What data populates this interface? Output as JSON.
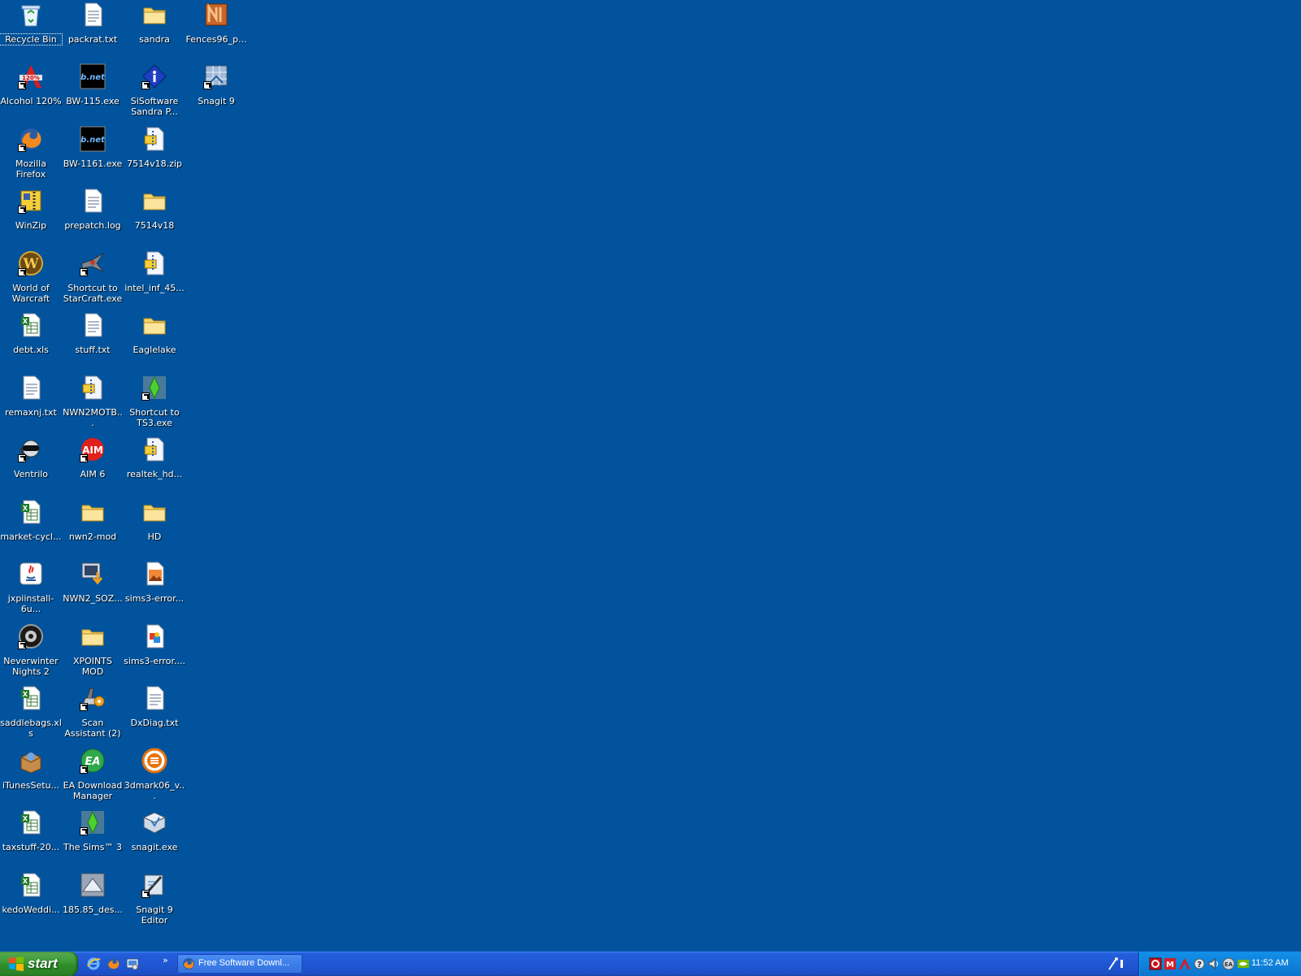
{
  "desktop": {
    "background_color": "#00539c",
    "selected_icon": "Recycle Bin",
    "icons": [
      {
        "label": "Recycle Bin",
        "icon": "recycle-bin-icon"
      },
      {
        "label": "packrat.txt",
        "icon": "text-file-icon"
      },
      {
        "label": "sandra",
        "icon": "folder-icon"
      },
      {
        "label": "Fences96_p...",
        "icon": "installer-icon"
      },
      {
        "label": "Alcohol 120%",
        "icon": "alcohol-icon"
      },
      {
        "label": "BW-115.exe",
        "icon": "bnet-exe-icon"
      },
      {
        "label": "SiSoftware Sandra P...",
        "icon": "sisoftware-icon"
      },
      {
        "label": "Snagit 9",
        "icon": "snagit-icon"
      },
      {
        "label": "Mozilla Firefox",
        "icon": "firefox-icon"
      },
      {
        "label": "BW-1161.exe",
        "icon": "bnet-exe-icon"
      },
      {
        "label": "7514v18.zip",
        "icon": "zip-file-icon"
      },
      {
        "label": "WinZip",
        "icon": "winzip-icon"
      },
      {
        "label": "prepatch.log",
        "icon": "text-file-icon"
      },
      {
        "label": "7514v18",
        "icon": "folder-icon"
      },
      {
        "label": "World of Warcraft",
        "icon": "warcraft-icon"
      },
      {
        "label": "Shortcut to StarCraft.exe",
        "icon": "starcraft-icon"
      },
      {
        "label": "intel_inf_45...",
        "icon": "zip-file-icon"
      },
      {
        "label": "debt.xls",
        "icon": "excel-file-icon"
      },
      {
        "label": "stuff.txt",
        "icon": "text-file-icon"
      },
      {
        "label": "Eaglelake",
        "icon": "folder-icon"
      },
      {
        "label": "remaxnj.txt",
        "icon": "text-file-icon"
      },
      {
        "label": "NWN2MOTB...",
        "icon": "zip-file-icon"
      },
      {
        "label": "Shortcut to TS3.exe",
        "icon": "sims-icon"
      },
      {
        "label": "Ventrilo",
        "icon": "ventrilo-icon"
      },
      {
        "label": "AIM 6",
        "icon": "aim-icon"
      },
      {
        "label": "realtek_hd...",
        "icon": "zip-file-icon"
      },
      {
        "label": "market-cycl...",
        "icon": "excel-file-icon"
      },
      {
        "label": "nwn2-mod",
        "icon": "folder-icon"
      },
      {
        "label": "HD",
        "icon": "folder-icon"
      },
      {
        "label": "jxpiinstall-6u...",
        "icon": "java-icon"
      },
      {
        "label": "NWN2_SOZ...",
        "icon": "installer-icon"
      },
      {
        "label": "sims3-error...",
        "icon": "image-file-icon"
      },
      {
        "label": "Neverwinter Nights 2",
        "icon": "neverwinter-icon"
      },
      {
        "label": "XPOINTS MOD",
        "icon": "folder-icon"
      },
      {
        "label": "sims3-error....",
        "icon": "image-file-icon"
      },
      {
        "label": "saddlebags.xls",
        "icon": "excel-file-icon"
      },
      {
        "label": "Scan Assistant (2)",
        "icon": "scan-assistant-icon"
      },
      {
        "label": "DxDiag.txt",
        "icon": "text-file-icon"
      },
      {
        "label": "iTunesSetu...",
        "icon": "itunes-setup-icon"
      },
      {
        "label": "EA Download Manager",
        "icon": "ea-icon"
      },
      {
        "label": "3dmark06_v...",
        "icon": "3dmark-icon"
      },
      {
        "label": "taxstuff-20...",
        "icon": "excel-file-icon"
      },
      {
        "label": "The Sims™ 3",
        "icon": "sims-icon"
      },
      {
        "label": "snagit.exe",
        "icon": "snagit-installer-icon"
      },
      {
        "label": "kedoWeddi...",
        "icon": "excel-file-icon"
      },
      {
        "label": "185.85_des...",
        "icon": "nvidia-installer-icon"
      },
      {
        "label": "Snagit 9 Editor",
        "icon": "snagit-editor-icon"
      }
    ]
  },
  "taskbar": {
    "start_label": "start",
    "quick_launch": [
      "internet-explorer-icon",
      "firefox-icon",
      "show-desktop-icon"
    ],
    "quick_launch_more": "»",
    "task_buttons": [
      {
        "label": "Free Software Downl...",
        "icon": "firefox-icon"
      }
    ],
    "tray_icons": [
      "antivirus-icon",
      "mcafee-icon",
      "alcohol-tray-icon",
      "help-icon",
      "volume-icon",
      "ea-tray-icon",
      "nvidia-icon"
    ],
    "clock": "11:52 AM"
  }
}
